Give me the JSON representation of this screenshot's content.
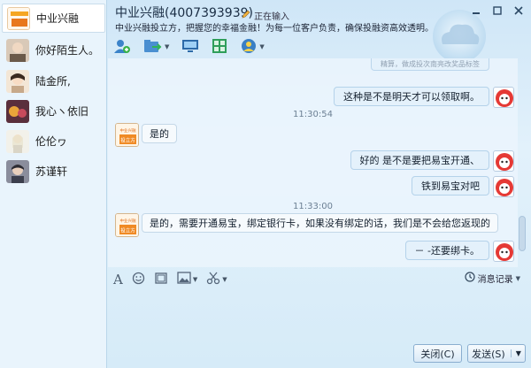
{
  "sidebar": {
    "contacts": [
      {
        "name": "中业兴融",
        "active": true
      },
      {
        "name": "你好陌生人。",
        "active": false
      },
      {
        "name": "陆金所,",
        "active": false
      },
      {
        "name": "我心ヽ依旧",
        "active": false
      },
      {
        "name": "伦伦ヮ",
        "active": false
      },
      {
        "name": "苏谨轩",
        "active": false
      }
    ]
  },
  "header": {
    "title": "中业兴融(4007393939)",
    "typing": "正在输入",
    "motto": "中业兴融投立方，把握您的幸福金融！为每一位客户负责，确保投融资高效透明。"
  },
  "chat": {
    "partial_text": "精算，做成投次南亮改奖品标签",
    "messages": [
      {
        "side": "right",
        "text": "这种是不是明天才可以领取啊。"
      },
      {
        "time": "11:30:54"
      },
      {
        "side": "left",
        "text": "是的"
      },
      {
        "side": "right",
        "text": "好的    是不是要把易宝开通、"
      },
      {
        "side": "right",
        "text": "铁到易宝对吧"
      },
      {
        "time": "11:33:00"
      },
      {
        "side": "left",
        "text": "是的，需要开通易宝，绑定银行卡，如果没有绑定的话，我们是不会给您返现的"
      },
      {
        "side": "right",
        "text": "－ -还要绑卡。"
      }
    ],
    "brand_top": "中业兴融",
    "brand_bottom": "投立方"
  },
  "input_toolbar": {
    "history_label": "消息记录"
  },
  "buttons": {
    "close": "关闭(C)",
    "send": "发送(S)"
  },
  "colors": {
    "accent": "#2f7cc0",
    "bubble_right": "#e4f1fb",
    "bubble_left": "#f6fafd"
  }
}
